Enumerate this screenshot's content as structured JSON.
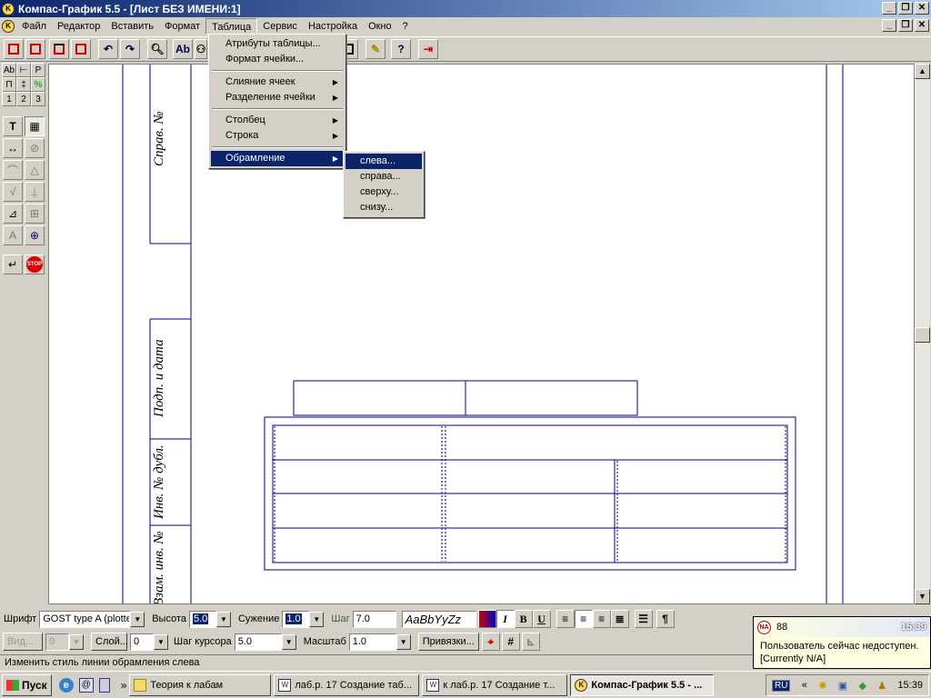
{
  "window": {
    "title": "Компас-График 5.5 - [Лист БЕЗ ИМЕНИ:1]",
    "app_icon": "kompas-logo-icon",
    "controls": [
      "_",
      "❐",
      "✕"
    ]
  },
  "menubar": {
    "items": [
      "Файл",
      "Редактор",
      "Вставить",
      "Формат",
      "Таблица",
      "Сервис",
      "Настройка",
      "Окно",
      "?"
    ],
    "active": "Таблица"
  },
  "table_menu": {
    "items": [
      {
        "label": "Атрибуты таблицы...",
        "submenu": false
      },
      {
        "label": "Формат ячейки...",
        "submenu": false
      },
      {
        "label": "Слияние ячеек",
        "submenu": true
      },
      {
        "label": "Разделение ячейки",
        "submenu": true
      },
      {
        "label": "Столбец",
        "submenu": true
      },
      {
        "label": "Строка",
        "submenu": true
      },
      {
        "label": "Обрамление",
        "submenu": true,
        "highlighted": true
      }
    ]
  },
  "border_submenu": {
    "items": [
      "слева...",
      "справа...",
      "сверху...",
      "снизу..."
    ],
    "highlighted": "слева..."
  },
  "toolbar": {
    "text_button_label": "Ab",
    "icons": [
      "frame-icon",
      "frame-icon",
      "frame-icon",
      "frame-icon",
      "undo-icon",
      "redo-icon",
      "search-icon",
      "text-icon",
      "link-icon",
      "pen-icon",
      "help-icon",
      "exit-icon"
    ]
  },
  "left_panel": {
    "small_buttons": [
      "Ab",
      "⊢",
      "P",
      "П",
      "‡",
      "%",
      "1",
      "2",
      "3"
    ]
  },
  "drawing": {
    "stamp_labels": [
      "Справ. №",
      "Подп. и дата",
      "Инв. № дубл.",
      "Взам. инв. №"
    ]
  },
  "format_bar": {
    "font_label": "Шрифт",
    "font_value": "GOST type A (plotter)",
    "height_label": "Высота",
    "height_value": "5.0",
    "narrow_label": "Сужение",
    "narrow_value": "1.0",
    "step_label": "Шаг",
    "step_value": "7.0",
    "sample": "AaBbYyZz",
    "italic": "I",
    "bold": "B",
    "underline": "U",
    "para": "¶"
  },
  "bottom_bar": {
    "view_label": "Вид...",
    "view_value": "0",
    "layer_label": "Слой...",
    "layer_value": "0",
    "cursor_step_label": "Шаг курсора",
    "cursor_step_value": "5.0",
    "scale_label": "Масштаб",
    "scale_value": "1.0",
    "snap_label": "Привязки..."
  },
  "status": {
    "text": "Изменить стиль линии обрамления слева"
  },
  "balloon": {
    "name": "88",
    "time": "15:39",
    "line1": "Пользователь сейчас недоступен.",
    "line2": "[Currently N/A]"
  },
  "taskbar": {
    "start": "Пуск",
    "chevron": "»",
    "tasks": [
      "Теория к лабам",
      "лаб.р. 17 Создание таб...",
      "к лаб.р. 17 Создание т...",
      "Компас-График 5.5 - ..."
    ],
    "lang": "RU",
    "clock": "15:39",
    "tray_chevron": "«"
  }
}
